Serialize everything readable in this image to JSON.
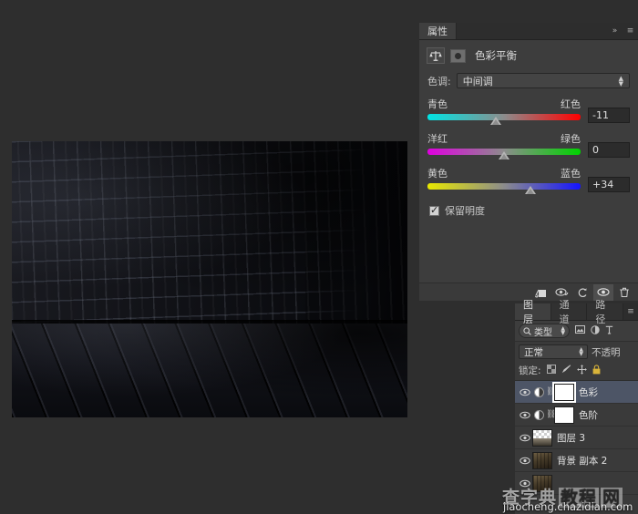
{
  "properties_panel": {
    "tabs": [
      {
        "label": "属性",
        "active": true
      }
    ],
    "header_icons": {
      "collapse": "»",
      "menu": "≡"
    },
    "adjustment": {
      "icon_name": "color-balance-scale-icon",
      "title": "色彩平衡"
    },
    "tone": {
      "label": "色调:",
      "value": "中间调"
    },
    "sliders": [
      {
        "left_label": "青色",
        "right_label": "红色",
        "value": "-11",
        "position_pct": 44.5
      },
      {
        "left_label": "洋红",
        "right_label": "绿色",
        "value": "0",
        "position_pct": 50.0
      },
      {
        "left_label": "黄色",
        "right_label": "蓝色",
        "value": "+34",
        "position_pct": 67.0
      }
    ],
    "preserve_luminosity": {
      "label": "保留明度",
      "checked": true
    },
    "footer_buttons": [
      {
        "name": "clip-to-layer-icon",
        "glyph": "⬓"
      },
      {
        "name": "view-previous-state-icon",
        "glyph": "👁"
      },
      {
        "name": "reset-icon",
        "glyph": "↺"
      },
      {
        "name": "toggle-visibility-icon",
        "glyph": "◉"
      },
      {
        "name": "delete-icon",
        "glyph": "🗑"
      }
    ]
  },
  "layers_panel": {
    "tabs": [
      {
        "label": "图层",
        "active": true
      },
      {
        "label": "通道",
        "active": false
      },
      {
        "label": "路径",
        "active": false
      }
    ],
    "header_icons": {
      "menu": "≡"
    },
    "filter": {
      "search_icon": "search-icon",
      "kind": "类型",
      "icons": [
        "pixel-filter-icon",
        "adjustment-filter-icon",
        "type-filter-icon"
      ]
    },
    "blend": {
      "mode": "正常",
      "opacity_label": "不透明"
    },
    "lock": {
      "label": "锁定:",
      "icons": [
        "lock-transparency-icon",
        "lock-image-icon",
        "lock-position-icon",
        "lock-all-icon"
      ]
    },
    "layers": [
      {
        "name": "色彩",
        "thumb": "mask-white",
        "kind": "adjustment",
        "selected": true,
        "visible": true,
        "linked": true
      },
      {
        "name": "色阶",
        "thumb": "mask-white",
        "kind": "adjustment",
        "selected": false,
        "visible": true,
        "linked": true
      },
      {
        "name": "图层 3",
        "thumb": "checker",
        "kind": "pixel",
        "selected": false,
        "visible": true,
        "linked": false
      },
      {
        "name": "背景 副本 2",
        "thumb": "photo",
        "kind": "pixel",
        "selected": false,
        "visible": true,
        "linked": false
      },
      {
        "name": "",
        "thumb": "photo",
        "kind": "pixel",
        "selected": false,
        "visible": true,
        "linked": false
      }
    ]
  },
  "watermark": {
    "cn_left": "查字典",
    "cn_right_1": "教程",
    "cn_right_2": "网",
    "url": "jiaocheng.chazidian.com"
  }
}
